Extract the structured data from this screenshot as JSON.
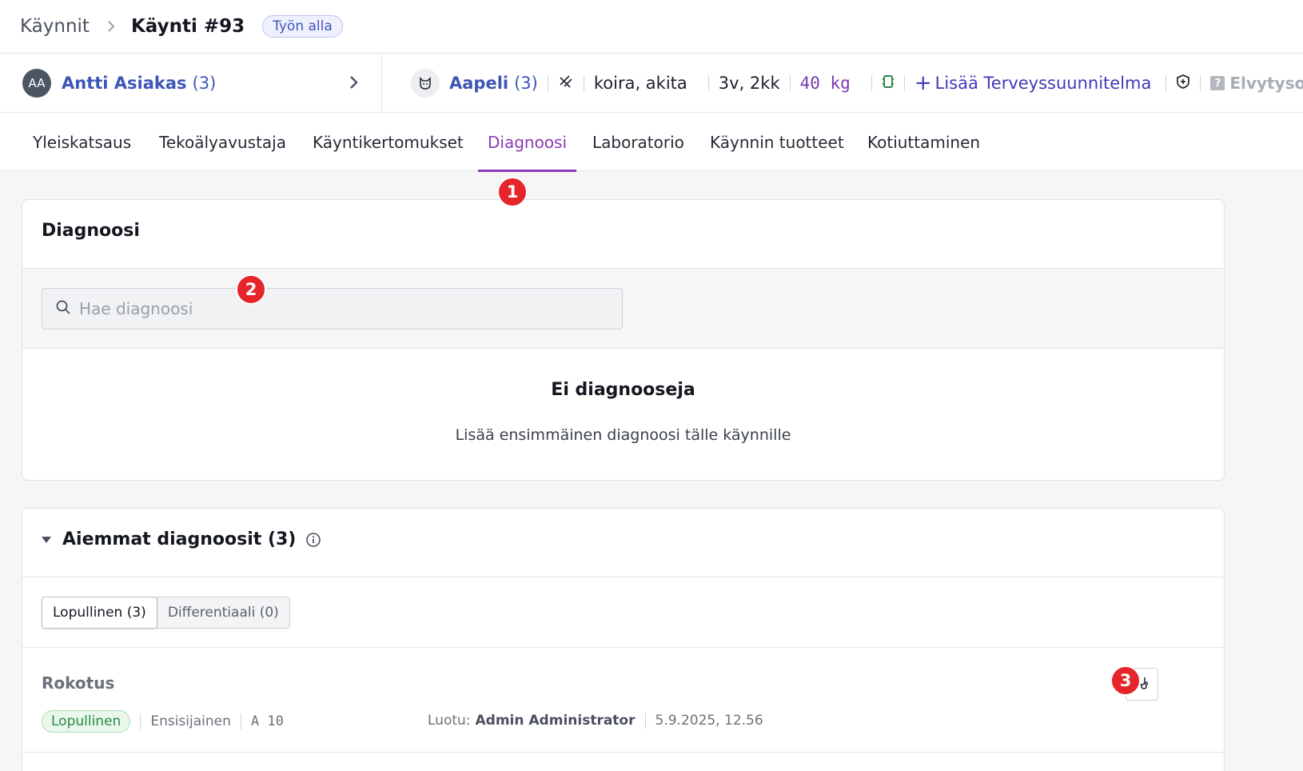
{
  "breadcrumb": {
    "root": "Käynnit",
    "current": "Käynti #93",
    "status": "Työn alla"
  },
  "owner": {
    "initials": "AA",
    "name": "Antti Asiakas",
    "count": "(3)"
  },
  "pet": {
    "name": "Aapeli",
    "count": "(3)",
    "species": "koira, akita",
    "age": "3v, 2kk",
    "weight": "40 kg",
    "add_plan": "Lisää Terveyssuunnitelma",
    "cpr": "Elvytysohje"
  },
  "tabs": [
    {
      "label": "Yleiskatsaus"
    },
    {
      "label": "Tekoälyavustaja"
    },
    {
      "label": "Käyntikertomukset"
    },
    {
      "label": "Diagnoosi"
    },
    {
      "label": "Laboratorio"
    },
    {
      "label": "Käynnin tuotteet"
    },
    {
      "label": "Kotiuttaminen"
    }
  ],
  "active_tab": "Diagnoosi",
  "markers": [
    "1",
    "2",
    "3"
  ],
  "diagnosis": {
    "title": "Diagnoosi",
    "search_placeholder": "Hae diagnoosi",
    "empty_title": "Ei diagnooseja",
    "empty_subtitle": "Lisää ensimmäinen diagnoosi tälle käynnille"
  },
  "previous": {
    "title": "Aiemmat diagnoosit (3)",
    "segments": [
      "Lopullinen (3)",
      "Differentiaali (0)"
    ],
    "items": [
      {
        "name": "Rokotus",
        "status": "Lopullinen",
        "priority": "Ensisijainen",
        "code": "A 10",
        "created_label": "Luotu:",
        "created_by": "Admin Administrator",
        "created_at": "5.9.2025, 12.56"
      }
    ]
  },
  "colors": {
    "accent": "#8a3ab5",
    "link": "#3e55b8",
    "marker": "#e5252a",
    "success": "#2c8a47"
  }
}
